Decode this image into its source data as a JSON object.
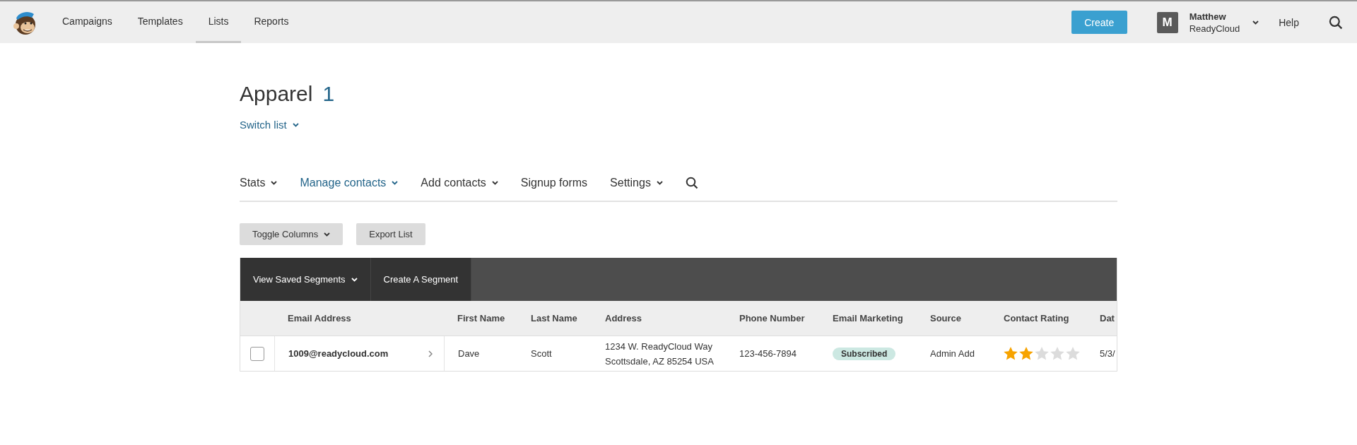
{
  "header": {
    "nav": [
      {
        "label": "Campaigns",
        "selected": false
      },
      {
        "label": "Templates",
        "selected": false
      },
      {
        "label": "Lists",
        "selected": true
      },
      {
        "label": "Reports",
        "selected": false
      }
    ],
    "create_button": "Create",
    "account": {
      "initial": "M",
      "name": "Matthew",
      "company": "ReadyCloud"
    },
    "help": "Help"
  },
  "list": {
    "title": "Apparel",
    "count": "1",
    "switch": "Switch list"
  },
  "tabs": [
    {
      "label": "Stats",
      "selected": false,
      "dropdown": true
    },
    {
      "label": "Manage contacts",
      "selected": true,
      "dropdown": true
    },
    {
      "label": "Add contacts",
      "selected": false,
      "dropdown": true
    },
    {
      "label": "Signup forms",
      "selected": false,
      "dropdown": false
    },
    {
      "label": "Settings",
      "selected": false,
      "dropdown": true
    }
  ],
  "actions": [
    {
      "label": "Toggle Columns",
      "dropdown": true
    },
    {
      "label": "Export List",
      "dropdown": false
    }
  ],
  "segments": [
    {
      "label": "View Saved Segments",
      "dropdown": true
    },
    {
      "label": "Create A Segment",
      "dropdown": false
    }
  ],
  "table": {
    "columns": [
      "Email Address",
      "First Name",
      "Last Name",
      "Address",
      "Phone Number",
      "Email Marketing",
      "Source",
      "Contact Rating",
      "Dat"
    ],
    "rows": [
      {
        "checked": false,
        "email": "1009@readycloud.com",
        "first_name": "Dave",
        "last_name": "Scott",
        "address": [
          "1234 W. ReadyCloud Way",
          "Scottsdale, AZ 85254 USA"
        ],
        "phone": "123-456-7894",
        "email_marketing": "Subscribed",
        "source": "Admin Add",
        "stars": 2,
        "date": "5/3/"
      }
    ]
  }
}
